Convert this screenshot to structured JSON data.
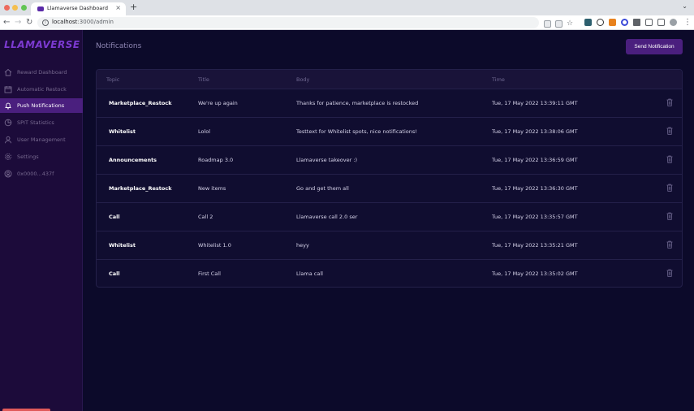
{
  "browser": {
    "tab_title": "Llamaverse Dashboard",
    "tab_close": "×",
    "new_tab": "+",
    "url_host": "localhost",
    "url_path": ":3000/admin"
  },
  "app": {
    "logo": "LLAMAVERSE",
    "page_title": "Notifications",
    "send_button_label": "Send Notification"
  },
  "sidebar": {
    "items": [
      {
        "label": "Reward Dashboard",
        "icon": "home-icon",
        "active": false
      },
      {
        "label": "Automatic Restock",
        "icon": "calendar-icon",
        "active": false
      },
      {
        "label": "Push Notifications",
        "icon": "bell-icon",
        "active": true
      },
      {
        "label": "SPIT Statistics",
        "icon": "pie-chart-icon",
        "active": false
      },
      {
        "label": "User Management",
        "icon": "user-icon",
        "active": false
      },
      {
        "label": "Settings",
        "icon": "gear-icon",
        "active": false
      },
      {
        "label": "0x0000...437f",
        "icon": "account-icon",
        "active": false
      }
    ]
  },
  "table": {
    "headers": {
      "topic": "Topic",
      "title": "Title",
      "body": "Body",
      "time": "Time"
    },
    "rows": [
      {
        "topic": "Marketplace_Restock",
        "title": "We're up again",
        "body": "Thanks for patience, marketplace is restocked",
        "time": "Tue, 17 May 2022 13:39:11 GMT"
      },
      {
        "topic": "Whitelist",
        "title": "Lolol",
        "body": "Testtext for Whitelist spots, nice notifications!",
        "time": "Tue, 17 May 2022 13:38:06 GMT"
      },
      {
        "topic": "Announcements",
        "title": "Roadmap 3.0",
        "body": "Llamaverse takeover :)",
        "time": "Tue, 17 May 2022 13:36:59 GMT"
      },
      {
        "topic": "Marketplace_Restock",
        "title": "New items",
        "body": "Go and get them all",
        "time": "Tue, 17 May 2022 13:36:30 GMT"
      },
      {
        "topic": "Call",
        "title": "Call 2",
        "body": "Llamaverse call 2.0 ser",
        "time": "Tue, 17 May 2022 13:35:57 GMT"
      },
      {
        "topic": "Whitelist",
        "title": "Whitelist 1.0",
        "body": "heyy",
        "time": "Tue, 17 May 2022 13:35:21 GMT"
      },
      {
        "topic": "Call",
        "title": "First Call",
        "body": "Llama call",
        "time": "Tue, 17 May 2022 13:35:02 GMT"
      }
    ]
  },
  "colors": {
    "accent": "#4a1f7e",
    "sidebar_bg": "#1c0b3a",
    "main_bg": "#0c0a2a",
    "logo": "#7c3ad1"
  }
}
